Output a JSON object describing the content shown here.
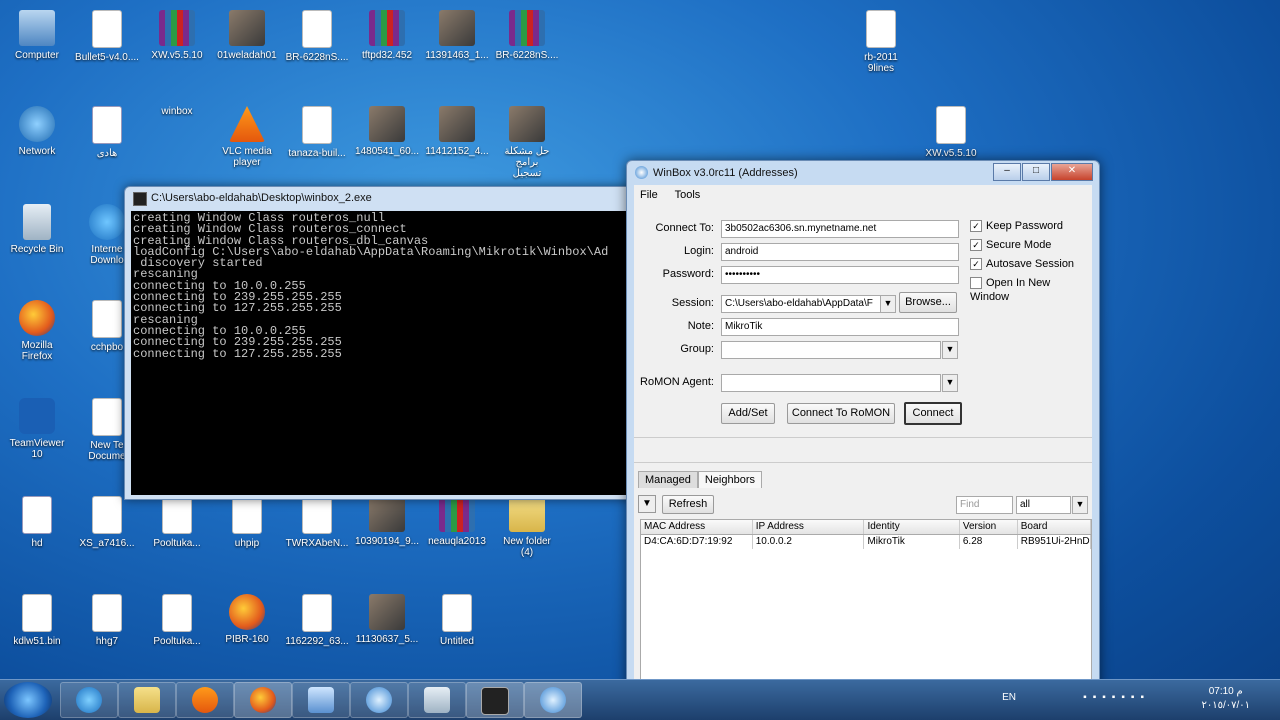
{
  "desktop_icons": [
    {
      "label": "Computer",
      "type": "comp"
    },
    {
      "label": "Bullet5-v4.0....",
      "type": "doc"
    },
    {
      "label": "XW.v5.5.10",
      "type": "rar"
    },
    {
      "label": "01weladah01",
      "type": "pic"
    },
    {
      "label": "BR-6228nS....",
      "type": "doc"
    },
    {
      "label": "tftpd32.452",
      "type": "rar"
    },
    {
      "label": "11391463_1...",
      "type": "pic"
    },
    {
      "label": "BR-6228nS....",
      "type": "rar"
    },
    {
      "label": "rb-2011\n9lines",
      "type": "doc"
    },
    {
      "label": "Network",
      "type": "net"
    },
    {
      "label": "هادى",
      "type": "word"
    },
    {
      "label": "winbox",
      "type": "winbox"
    },
    {
      "label": "VLC media\nplayer",
      "type": "vlc"
    },
    {
      "label": "tanaza-buil...",
      "type": "doc"
    },
    {
      "label": "1480541_60...",
      "type": "pic"
    },
    {
      "label": "11412152_4...",
      "type": "pic"
    },
    {
      "label": "حل مشكلة برامج\nتسجيل",
      "type": "pic"
    },
    {
      "label": "XW.v5.5.10",
      "type": "doc"
    },
    {
      "label": "Recycle Bin",
      "type": "bin"
    },
    {
      "label": "Interne\nDownlo",
      "type": "ie"
    },
    {
      "label": "Mozilla\nFirefox",
      "type": "ff"
    },
    {
      "label": "cchpbo",
      "type": "doc"
    },
    {
      "label": "TeamViewer\n10",
      "type": "tv"
    },
    {
      "label": "New Te\nDocume",
      "type": "doc"
    },
    {
      "label": "hd",
      "type": "word"
    },
    {
      "label": "XS_a7416...",
      "type": "doc"
    },
    {
      "label": "Pooltuka...",
      "type": "doc"
    },
    {
      "label": "uhpip",
      "type": "doc"
    },
    {
      "label": "TWRXAbeN...",
      "type": "doc"
    },
    {
      "label": "10390194_9...",
      "type": "pic"
    },
    {
      "label": "neauqla2013",
      "type": "rar"
    },
    {
      "label": "New folder\n(4)",
      "type": "folder"
    },
    {
      "label": "kdlw51.bin",
      "type": "doc"
    },
    {
      "label": "hhg7",
      "type": "doc"
    },
    {
      "label": "Pooltuka...",
      "type": "doc"
    },
    {
      "label": "PIBR-160",
      "type": "ff"
    },
    {
      "label": "1162292_63...",
      "type": "doc"
    },
    {
      "label": "11130637_5...",
      "type": "pic"
    },
    {
      "label": "Untitled",
      "type": "doc"
    }
  ],
  "console": {
    "title": "C:\\Users\\abo-eldahab\\Desktop\\winbox_2.exe",
    "lines": "creating Window Class routeros_null\ncreating Window Class routeros_connect\ncreating Window Class routeros_dbl_canvas\nloadConfig C:\\Users\\abo-eldahab\\AppData\\Roaming\\Mikrotik\\Winbox\\Ad\n discovery started\nrescaning\nconnecting to 10.0.0.255\nconnecting to 239.255.255.255\nconnecting to 127.255.255.255\nrescaning\nconnecting to 10.0.0.255\nconnecting to 239.255.255.255\nconnecting to 127.255.255.255"
  },
  "winbox": {
    "title": "WinBox v3.0rc11 (Addresses)",
    "menu": {
      "file": "File",
      "tools": "Tools"
    },
    "labels": {
      "connect_to": "Connect To:",
      "login": "Login:",
      "password": "Password:",
      "session": "Session:",
      "note": "Note:",
      "group": "Group:",
      "romon_agent": "RoMON Agent:"
    },
    "values": {
      "connect_to": "3b0502ac6306.sn.mynetname.net",
      "login": "android",
      "password": "••••••••••",
      "session": "C:\\Users\\abo-eldahab\\AppData\\F",
      "note": "MikroTik",
      "group": "",
      "romon_agent": ""
    },
    "buttons": {
      "browse": "Browse...",
      "add_set": "Add/Set",
      "connect_romon": "Connect To RoMON",
      "connect": "Connect",
      "refresh": "Refresh"
    },
    "checkboxes": [
      {
        "label": "Keep Password",
        "checked": true
      },
      {
        "label": "Secure Mode",
        "checked": true
      },
      {
        "label": "Autosave Session",
        "checked": true
      },
      {
        "label": "Open In New Window",
        "checked": false
      }
    ],
    "tabs": [
      "Managed",
      "Neighbors"
    ],
    "find_placeholder": "Find",
    "filter_value": "all",
    "columns": [
      "MAC Address",
      "IP Address",
      "Identity",
      "Version",
      "Board"
    ],
    "rows": [
      [
        "D4:CA:6D:D7:19:92",
        "10.0.0.2",
        "MikroTik",
        "6.28",
        "RB951Ui-2HnD"
      ]
    ]
  },
  "taskbar": {
    "language": "EN",
    "time": "07:10 م",
    "date": "٢٠١٥/٠٧/٠١"
  }
}
